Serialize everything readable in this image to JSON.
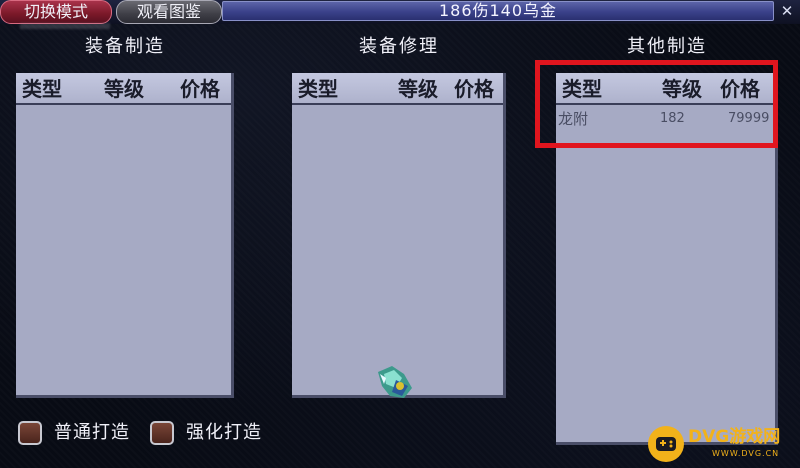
{
  "window": {
    "title": "186伤140乌金",
    "close_glyph": "✕"
  },
  "mode_buttons": {
    "switch_label": "切换模式",
    "gallery_label": "观看图鉴"
  },
  "panels": [
    {
      "title": "装备制造",
      "columns": [
        "类型",
        "等级",
        "价格"
      ],
      "rows": []
    },
    {
      "title": "装备修理",
      "columns": [
        "类型",
        "等级",
        "价格"
      ],
      "rows": []
    },
    {
      "title": "其他制造",
      "columns": [
        "类型",
        "等级",
        "价格"
      ],
      "rows": [
        {
          "type": "龙附",
          "level": "182",
          "price": "79999"
        }
      ]
    }
  ],
  "options": {
    "normal_label": "普通打造",
    "enhanced_label": "强化打造"
  },
  "highlight_color": "#e0151e",
  "icons": {
    "close": "close-icon",
    "gem": "gem-icon",
    "watermark_logo": "gamepad-logo-icon"
  },
  "watermark": {
    "text": "DVG游戏网",
    "sub": "WWW.DVG.CN"
  }
}
